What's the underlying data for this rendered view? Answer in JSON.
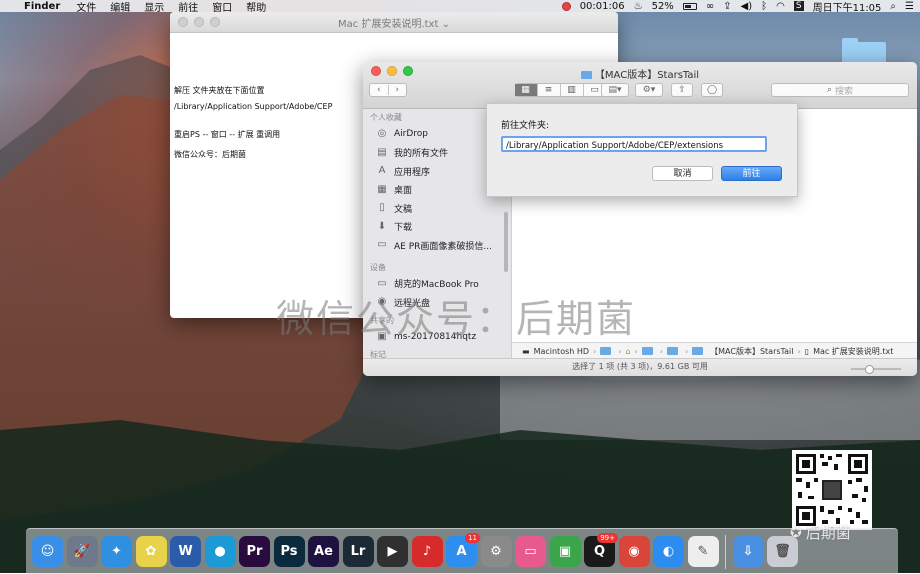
{
  "menubar": {
    "app_name": "Finder",
    "menus": [
      "文件",
      "编辑",
      "显示",
      "前往",
      "窗口",
      "帮助"
    ],
    "timer": "00:01:06",
    "battery": "52%",
    "user": "S",
    "clock": "周日下午11:05"
  },
  "textedit": {
    "title": "Mac 扩展安装说明.txt",
    "lines": [
      "解压 文件夹放在下面位置",
      "/Library/Application Support/Adobe/CEP",
      "",
      "重启PS -- 窗口 -- 扩展 重调用",
      "",
      "微信公众号：后期菌"
    ]
  },
  "finder": {
    "title": "【MAC版本】StarsTail",
    "search_placeholder": "搜索",
    "sidebar": {
      "favorites_header": "个人收藏",
      "favorites": [
        {
          "label": "AirDrop",
          "icon": "airdrop-icon"
        },
        {
          "label": "我的所有文件",
          "icon": "all-files-icon"
        },
        {
          "label": "应用程序",
          "icon": "applications-icon"
        },
        {
          "label": "桌面",
          "icon": "desktop-icon"
        },
        {
          "label": "文稿",
          "icon": "documents-icon"
        },
        {
          "label": "下载",
          "icon": "downloads-icon"
        },
        {
          "label": "AE PR画面像素破损信...",
          "icon": "folder-icon"
        }
      ],
      "devices_header": "设备",
      "devices": [
        {
          "label": "胡克的MacBook Pro",
          "icon": "laptop-icon"
        },
        {
          "label": "远程光盘",
          "icon": "disc-icon"
        }
      ],
      "shared_header": "共享的",
      "shared": [
        {
          "label": "ms-20170814hqtz",
          "icon": "monitor-icon"
        }
      ],
      "tags_header": "标记"
    },
    "path": [
      "Macintosh HD",
      "【MAC版本】StarsTail",
      "Mac 扩展安装说明.txt"
    ],
    "status": "选择了 1 项 (共 3 项)，9.61 GB 可用"
  },
  "goto_sheet": {
    "label": "前往文件夹:",
    "value": "/Library/Application Support/Adobe/CEP/extensions",
    "cancel_label": "取消",
    "go_label": "前往"
  },
  "watermark": "微信公众号：后期菌",
  "brand": "后期菌",
  "dock": [
    {
      "name": "finder-icon",
      "glyph": "☺",
      "color": "#3a8ee6"
    },
    {
      "name": "launchpad-icon",
      "glyph": "🚀",
      "color": "#6d7a8c"
    },
    {
      "name": "safari-icon",
      "glyph": "✦",
      "color": "#2f8fe0"
    },
    {
      "name": "photos-icon",
      "glyph": "✿",
      "color": "#e8d24a"
    },
    {
      "name": "word-icon",
      "glyph": "W",
      "color": "#2a5caa"
    },
    {
      "name": "screen-recorder-icon",
      "glyph": "●",
      "color": "#1c9ad6"
    },
    {
      "name": "premiere-icon",
      "glyph": "Pr",
      "color": "#2a0b3d"
    },
    {
      "name": "photoshop-icon",
      "glyph": "Ps",
      "color": "#0b2a3d"
    },
    {
      "name": "after-effects-icon",
      "glyph": "Ae",
      "color": "#1e1240"
    },
    {
      "name": "lightroom-icon",
      "glyph": "Lr",
      "color": "#1c2a36"
    },
    {
      "name": "final-cut-icon",
      "glyph": "▶",
      "color": "#303030"
    },
    {
      "name": "netease-music-icon",
      "glyph": "♪",
      "color": "#d72b2b"
    },
    {
      "name": "app-store-icon",
      "glyph": "A",
      "color": "#2d8ef0",
      "badge": "11"
    },
    {
      "name": "system-preferences-icon",
      "glyph": "⚙",
      "color": "#8a8a8a"
    },
    {
      "name": "screen-sharing-icon",
      "glyph": "▭",
      "color": "#e65a8e"
    },
    {
      "name": "facetime-icon",
      "glyph": "▣",
      "color": "#3aa54a"
    },
    {
      "name": "qq-icon",
      "glyph": "Q",
      "color": "#1a1a1a",
      "badge": "99+"
    },
    {
      "name": "chrome-icon",
      "glyph": "◉",
      "color": "#d9453b"
    },
    {
      "name": "video-chat-icon",
      "glyph": "◐",
      "color": "#2d8cf0"
    },
    {
      "name": "notes-icon",
      "glyph": "✎",
      "color": "#eeeeee"
    },
    {
      "name": "downloads-stack-icon",
      "glyph": "⇩",
      "color": "#4a90e2"
    },
    {
      "name": "trash-icon",
      "glyph": "🗑",
      "color": "#c9ccd2"
    }
  ]
}
